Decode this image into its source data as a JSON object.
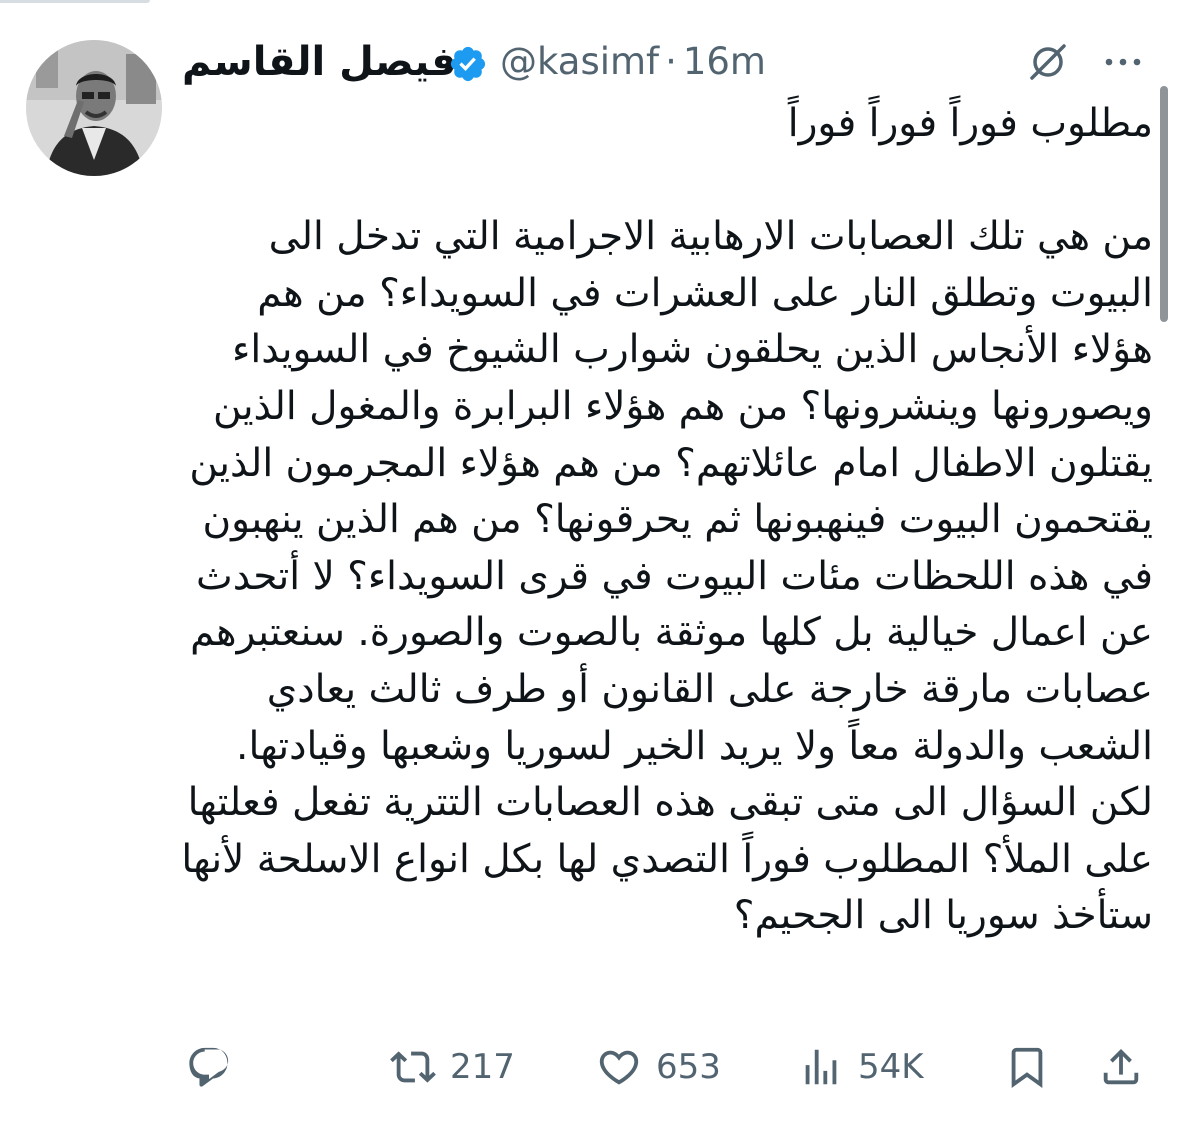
{
  "tweet": {
    "author_name": "فيصل القاسم",
    "handle": "@kasimf",
    "separator": "·",
    "time": "16m",
    "text": "مطلوب فوراً فوراً فوراً\n\nمن هي تلك العصابات الارهابية الاجرامية التي تدخل الى البيوت وتطلق النار على العشرات في السويداء؟ من هم هؤلاء الأنجاس الذين يحلقون شوارب الشيوخ في السويداء ويصورونها وينشرونها؟ من هم هؤلاء البرابرة والمغول الذين يقتلون الاطفال امام عائلاتهم؟ من هم هؤلاء المجرمون الذين يقتحمون البيوت فينهبونها ثم يحرقونها؟ من هم الذين ينهبون في هذه اللحظات مئات البيوت في قرى السويداء؟ لا أتحدث عن اعمال خيالية بل كلها موثقة بالصوت والصورة. سنعتبرهم عصابات مارقة خارجة على القانون أو طرف ثالث يعادي الشعب والدولة معاً ولا يريد الخير لسوريا وشعبها وقيادتها. لكن السؤال الى متى تبقى هذه العصابات التترية تفعل فعلتها على الملأ؟ المطلوب فوراً التصدي لها بكل انواع الاسلحة لأنها ستأخذ سوريا الى الجحيم؟"
  },
  "actions": {
    "replies": "",
    "retweets": "217",
    "likes": "653",
    "views": "54K"
  },
  "icons": {
    "verified": "verified-badge-icon",
    "grok": "grok-icon",
    "more": "more-dots-icon",
    "reply": "reply-icon",
    "retweet": "retweet-icon",
    "like": "heart-icon",
    "views": "views-bar-icon",
    "bookmark": "bookmark-icon",
    "share": "share-icon"
  },
  "colors": {
    "verified": "#1d9bf0",
    "text": "#0f1419",
    "secondary": "#536471"
  }
}
